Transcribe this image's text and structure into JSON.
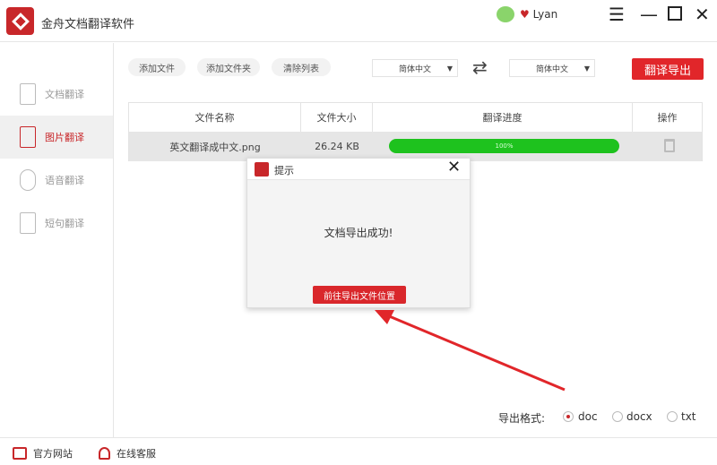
{
  "app": {
    "title": "金舟文档翻译软件",
    "user": "Lyan"
  },
  "sidebar": {
    "items": [
      {
        "label": "文档翻译"
      },
      {
        "label": "图片翻译"
      },
      {
        "label": "语音翻译"
      },
      {
        "label": "短句翻译"
      }
    ]
  },
  "toolbar": {
    "add_file": "添加文件",
    "add_folder": "添加文件夹",
    "clear_list": "清除列表",
    "source_lang": "简体中文",
    "target_lang": "简体中文",
    "export": "翻译导出"
  },
  "table": {
    "headers": [
      "文件名称",
      "文件大小",
      "翻译进度",
      "操作"
    ],
    "rows": [
      {
        "name": "英文翻译成中文.png",
        "size": "26.24 KB",
        "progress": 100,
        "progress_label": "100%"
      }
    ]
  },
  "dialog": {
    "title": "提示",
    "message": "文档导出成功!",
    "button": "前往导出文件位置"
  },
  "export_format": {
    "label": "导出格式:",
    "options": [
      "doc",
      "docx",
      "txt"
    ],
    "selected": "doc"
  },
  "footer": {
    "website": "官方网站",
    "support": "在线客服"
  },
  "colors": {
    "accent": "#e1262a",
    "progress": "#1ec21e"
  }
}
